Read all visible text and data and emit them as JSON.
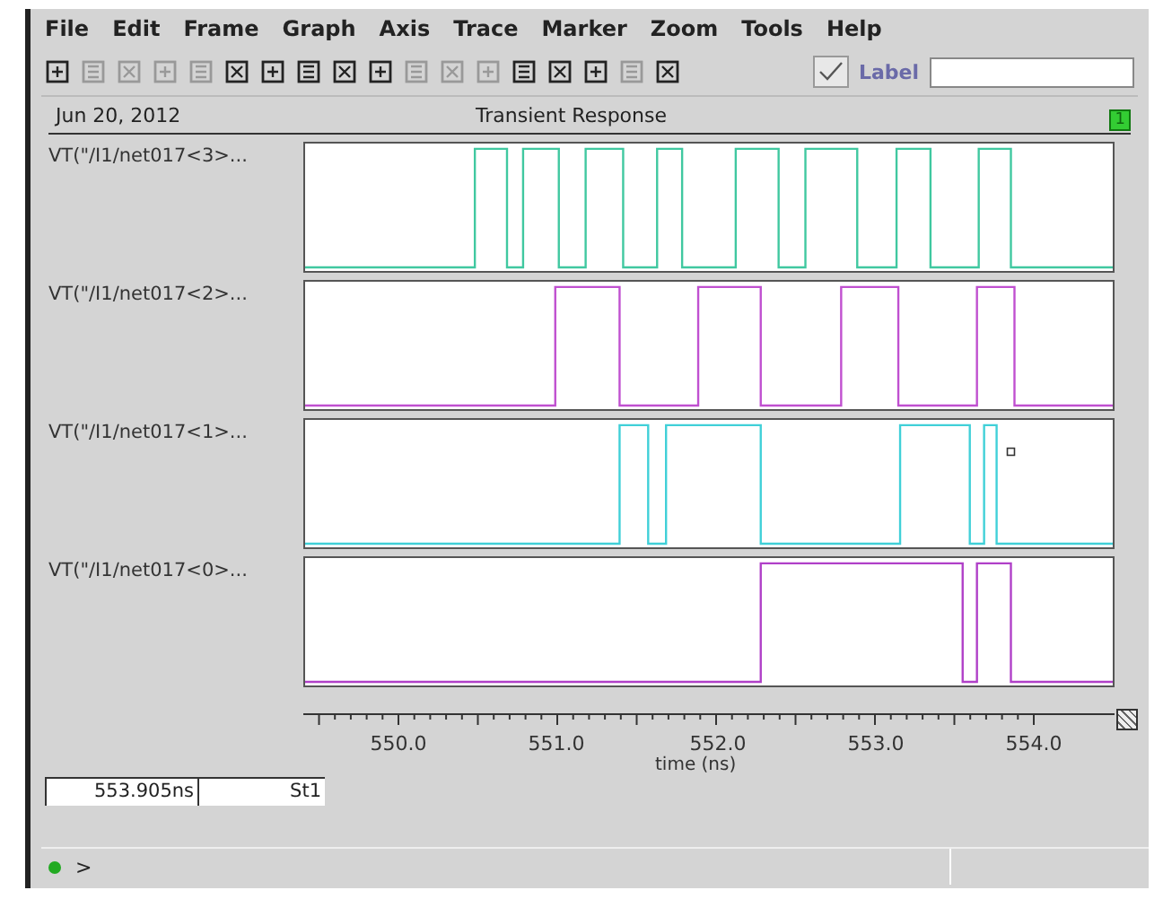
{
  "menu": [
    "File",
    "Edit",
    "Frame",
    "Graph",
    "Axis",
    "Trace",
    "Marker",
    "Zoom",
    "Tools",
    "Help"
  ],
  "toolbar": [
    {
      "disabled": false
    },
    {
      "disabled": true
    },
    {
      "disabled": true
    },
    {
      "disabled": true
    },
    {
      "disabled": true
    },
    {
      "disabled": false
    },
    {
      "disabled": false
    },
    {
      "disabled": false
    },
    {
      "disabled": false
    },
    {
      "disabled": false
    },
    {
      "disabled": true
    },
    {
      "disabled": true
    },
    {
      "disabled": true
    },
    {
      "disabled": false
    },
    {
      "disabled": false
    },
    {
      "disabled": false
    },
    {
      "disabled": true
    },
    {
      "disabled": false
    }
  ],
  "label_toggle": {
    "label": "Label",
    "checked": true
  },
  "header": {
    "date": "Jun 20, 2012",
    "title": "Transient Response",
    "badge": "1"
  },
  "traces": [
    {
      "name": "VT(\"/I1/net017<3>...",
      "color": "#40c8a0"
    },
    {
      "name": "VT(\"/I1/net017<2>...",
      "color": "#c050d0"
    },
    {
      "name": "VT(\"/I1/net017<1>...",
      "color": "#40d0d8"
    },
    {
      "name": "VT(\"/I1/net017<0>...",
      "color": "#b040c8"
    }
  ],
  "axis": {
    "ticks": [
      "550.0",
      "551.0",
      "552.0",
      "553.0",
      "554.0"
    ],
    "xlabel": "time (ns)"
  },
  "cursor_fields": [
    "553.905ns",
    "St1"
  ],
  "prompt": ">"
}
